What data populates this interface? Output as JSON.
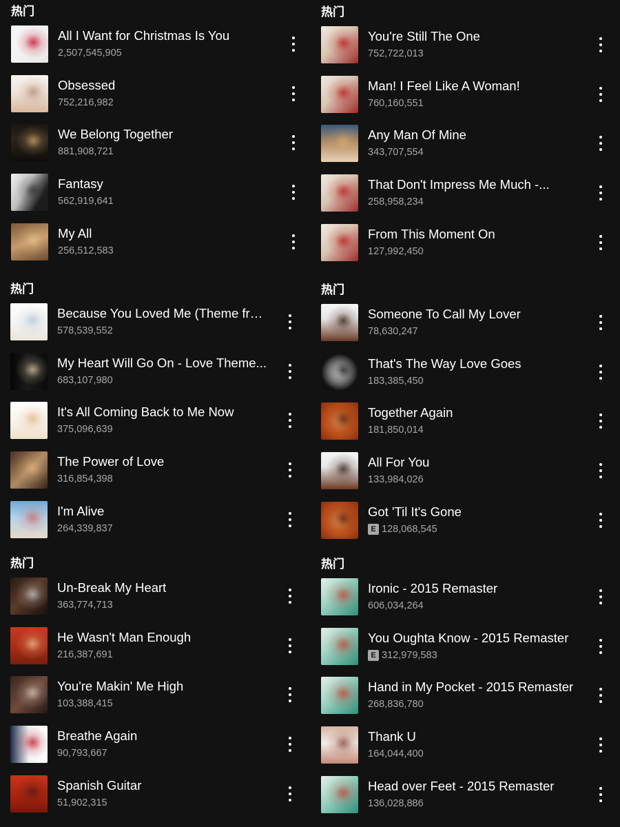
{
  "sections": [
    {
      "title": "热门",
      "tracks": [
        {
          "title": "All I Want for Christmas Is You",
          "plays": "2,507,545,905",
          "explicit": false,
          "cover": {
            "bg": "linear-gradient(135deg,#f4f4f4 0%,#f4f4f4 40%,#e8e6e4 100%)",
            "accent": "#c8102e"
          }
        },
        {
          "title": "Obsessed",
          "plays": "752,216,982",
          "explicit": false,
          "cover": {
            "bg": "linear-gradient(180deg,#f7f3ee 0%,#efe5da 45%,#d9b79e 100%)",
            "accent": "#b98d76"
          }
        },
        {
          "title": "We Belong Together",
          "plays": "881,908,721",
          "explicit": false,
          "cover": {
            "bg": "linear-gradient(180deg,#1a1612 0%,#2c241d 40%,#0f0d0b 100%)",
            "accent": "#c9a064"
          }
        },
        {
          "title": "Fantasy",
          "plays": "562,919,641",
          "explicit": false,
          "cover": {
            "bg": "linear-gradient(120deg,#f2f2f2 0%,#bdbdbd 40%,#1c1c1c 75%)",
            "accent": "#333333"
          }
        },
        {
          "title": "My All",
          "plays": "256,512,583",
          "explicit": false,
          "cover": {
            "bg": "linear-gradient(160deg,#7b5a3a 0%,#c89b6c 50%,#6b4a2e 100%)",
            "accent": "#e2c08f"
          }
        }
      ]
    },
    {
      "title": "热门",
      "tracks": [
        {
          "title": "Because You Loved Me (Theme from...",
          "plays": "578,539,552",
          "explicit": false,
          "cover": {
            "bg": "linear-gradient(180deg,#ffffff 0%,#f3f1ee 60%,#e9e4dd 100%)",
            "accent": "#b7c6d9"
          }
        },
        {
          "title": "My Heart Will Go On - Love Theme...",
          "plays": "683,107,980",
          "explicit": false,
          "cover": {
            "bg": "linear-gradient(90deg,#050505 0%,#1b1b1b 45%,#0a0a0a 100%)",
            "accent": "#d8c3a1"
          }
        },
        {
          "title": "It's All Coming Back to Me Now",
          "plays": "375,096,639",
          "explicit": false,
          "cover": {
            "bg": "linear-gradient(180deg,#ffffff 0%,#f6f1e9 60%,#efe0c9 100%)",
            "accent": "#e2b98a"
          }
        },
        {
          "title": "The Power of Love",
          "plays": "316,854,398",
          "explicit": false,
          "cover": {
            "bg": "linear-gradient(135deg,#4a2f22 0%,#b08a63 50%,#3a2418 100%)",
            "accent": "#d9b27c"
          }
        },
        {
          "title": "I'm Alive",
          "plays": "264,339,837",
          "explicit": false,
          "cover": {
            "bg": "linear-gradient(180deg,#6fa8d6 0%,#b6d4ea 45%,#e6d8c8 100%)",
            "accent": "#c96f6f"
          }
        }
      ]
    },
    {
      "title": "热门",
      "tracks": [
        {
          "title": "Un-Break My Heart",
          "plays": "363,774,713",
          "explicit": false,
          "cover": {
            "bg": "linear-gradient(135deg,#2a1a12 0%,#5a3a2a 45%,#1a0f0a 100%)",
            "accent": "#c2c2c2"
          }
        },
        {
          "title": "He Wasn't Man Enough",
          "plays": "216,387,691",
          "explicit": false,
          "cover": {
            "bg": "linear-gradient(180deg,#c43a1e 0%,#a72c14 55%,#7a1f0e 100%)",
            "accent": "#f0b08a"
          }
        },
        {
          "title": "You're Makin' Me High",
          "plays": "103,388,415",
          "explicit": false,
          "cover": {
            "bg": "linear-gradient(135deg,#3a2520 0%,#6e4a3b 50%,#2a1812 100%)",
            "accent": "#d2c1b0"
          }
        },
        {
          "title": "Breathe Again",
          "plays": "90,793,667",
          "explicit": false,
          "cover": {
            "bg": "linear-gradient(90deg,#1e2a4a 0%,#f2f2f2 50%,#ffffff 100%)",
            "accent": "#c21f2e"
          }
        },
        {
          "title": "Spanish Guitar",
          "plays": "51,902,315",
          "explicit": false,
          "cover": {
            "bg": "linear-gradient(180deg,#c9321a 0%,#a7230f 60%,#7a170a 100%)",
            "accent": "#5a1a10"
          }
        }
      ]
    },
    {
      "title": "热门",
      "tracks": [
        {
          "title": "You're Still The One",
          "plays": "752,722,013",
          "explicit": false,
          "cover": {
            "bg": "linear-gradient(135deg,#f1e9e1 0%,#d8c4b2 45%,#9c2a2a 100%)",
            "accent": "#b81e1e"
          }
        },
        {
          "title": "Man! I Feel Like A Woman!",
          "plays": "760,160,551",
          "explicit": false,
          "cover": {
            "bg": "linear-gradient(135deg,#f1e9e1 0%,#d8c4b2 45%,#9c2a2a 100%)",
            "accent": "#b81e1e"
          }
        },
        {
          "title": "Any Man Of Mine",
          "plays": "343,707,554",
          "explicit": false,
          "cover": {
            "bg": "linear-gradient(180deg,#3a5a7a 0%,#b89068 50%,#e8d2b6 100%)",
            "accent": "#d6a86a"
          }
        },
        {
          "title": "That Don't Impress Me Much -...",
          "plays": "258,958,234",
          "explicit": false,
          "cover": {
            "bg": "linear-gradient(135deg,#f1e9e1 0%,#d8c4b2 45%,#9c2a2a 100%)",
            "accent": "#b81e1e"
          }
        },
        {
          "title": "From This Moment On",
          "plays": "127,992,450",
          "explicit": false,
          "cover": {
            "bg": "linear-gradient(135deg,#f1e9e1 0%,#d8c4b2 45%,#9c2a2a 100%)",
            "accent": "#b81e1e"
          }
        }
      ]
    },
    {
      "title": "热门",
      "tracks": [
        {
          "title": "Someone To Call My Lover",
          "plays": "78,630,247",
          "explicit": false,
          "cover": {
            "bg": "linear-gradient(180deg,#f5f5f5 0%,#e6e6e6 40%,#6b3a24 100%)",
            "accent": "#3a1f14"
          }
        },
        {
          "title": "That's The Way Love Goes",
          "plays": "183,385,450",
          "explicit": false,
          "cover": {
            "bg": "radial-gradient(circle at 50% 50%,#e8e8e8 0%,#8a8a8a 35%,#111111 70%)",
            "accent": "#222222"
          }
        },
        {
          "title": "Together Again",
          "plays": "181,850,014",
          "explicit": false,
          "cover": {
            "bg": "radial-gradient(circle at 50% 50%,#f0a060 0%,#c4561e 45%,#8a2d0c 100%)",
            "accent": "#5a1e0a"
          }
        },
        {
          "title": "All For You",
          "plays": "133,984,026",
          "explicit": false,
          "cover": {
            "bg": "linear-gradient(180deg,#f5f5f5 0%,#e6e6e6 40%,#6b3a24 100%)",
            "accent": "#3a1f14"
          }
        },
        {
          "title": "Got 'Til It's Gone",
          "plays": "128,068,545",
          "explicit": true,
          "cover": {
            "bg": "radial-gradient(circle at 50% 50%,#f0a060 0%,#c4561e 45%,#8a2d0c 100%)",
            "accent": "#5a1e0a"
          }
        }
      ]
    },
    {
      "title": "热门",
      "tracks": [
        {
          "title": "Ironic - 2015 Remaster",
          "plays": "606,034,264",
          "explicit": false,
          "cover": {
            "bg": "linear-gradient(135deg,#e6efe9 0%,#9fd3c4 40%,#2f8f7a 100%)",
            "accent": "#c24a3a"
          }
        },
        {
          "title": "You Oughta Know - 2015 Remaster",
          "plays": "312,979,583",
          "explicit": true,
          "cover": {
            "bg": "linear-gradient(135deg,#e6efe9 0%,#9fd3c4 40%,#2f8f7a 100%)",
            "accent": "#c24a3a"
          }
        },
        {
          "title": "Hand in My Pocket - 2015 Remaster",
          "plays": "268,836,780",
          "explicit": false,
          "cover": {
            "bg": "linear-gradient(135deg,#e6efe9 0%,#9fd3c4 40%,#2f8f7a 100%)",
            "accent": "#c24a3a"
          }
        },
        {
          "title": "Thank U",
          "plays": "164,044,400",
          "explicit": false,
          "cover": {
            "bg": "linear-gradient(180deg,#d9b3a1 0%,#f2ece8 45%,#c48a76 100%)",
            "accent": "#8a4a3a"
          }
        },
        {
          "title": "Head over Feet - 2015 Remaster",
          "plays": "136,028,886",
          "explicit": false,
          "cover": {
            "bg": "linear-gradient(135deg,#e6efe9 0%,#9fd3c4 40%,#2f8f7a 100%)",
            "accent": "#c24a3a"
          }
        }
      ]
    }
  ],
  "explicit_label": "E"
}
